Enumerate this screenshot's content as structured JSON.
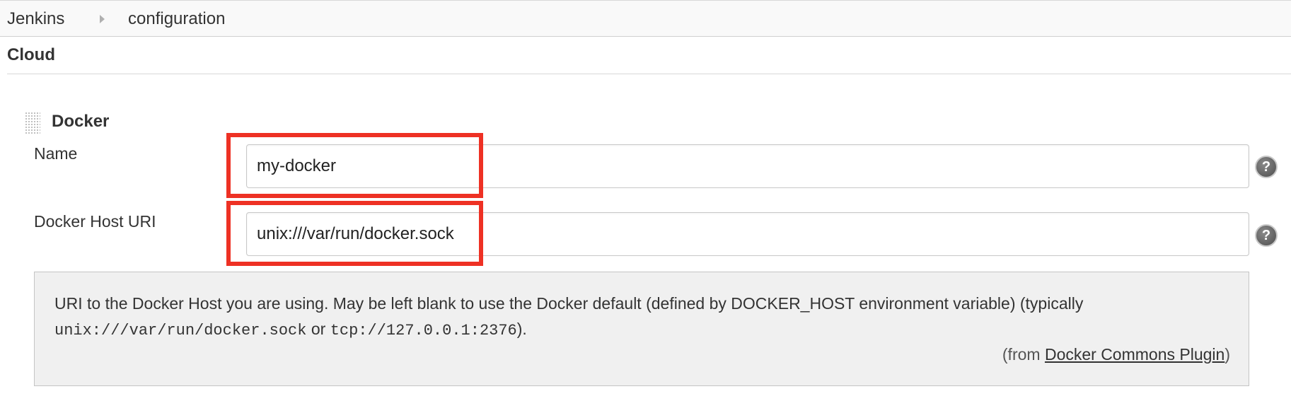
{
  "breadcrumb": {
    "items": [
      "Jenkins",
      "configuration"
    ]
  },
  "section": {
    "title": "Cloud"
  },
  "docker": {
    "title": "Docker",
    "name_label": "Name",
    "name_value": "my-docker",
    "host_uri_label": "Docker Host URI",
    "host_uri_value": "unix:///var/run/docker.sock"
  },
  "help": {
    "text_before": "URI to the Docker Host you are using. May be left blank to use the Docker default (defined by DOCKER_HOST environment variable) (typically",
    "code1": "unix:///var/run/docker.sock",
    "or": "or",
    "code2": "tcp://127.0.0.1:2376",
    "text_after": ").",
    "from_prefix": "(from",
    "from_link": "Docker Commons Plugin",
    "from_suffix": ")"
  },
  "icons": {
    "help": "help-icon",
    "breadcrumb_separator": "chevron-right-icon",
    "drag": "drag-handle-icon"
  },
  "colors": {
    "highlight": "#ee3124",
    "help_box_bg": "#f0f0f0"
  }
}
